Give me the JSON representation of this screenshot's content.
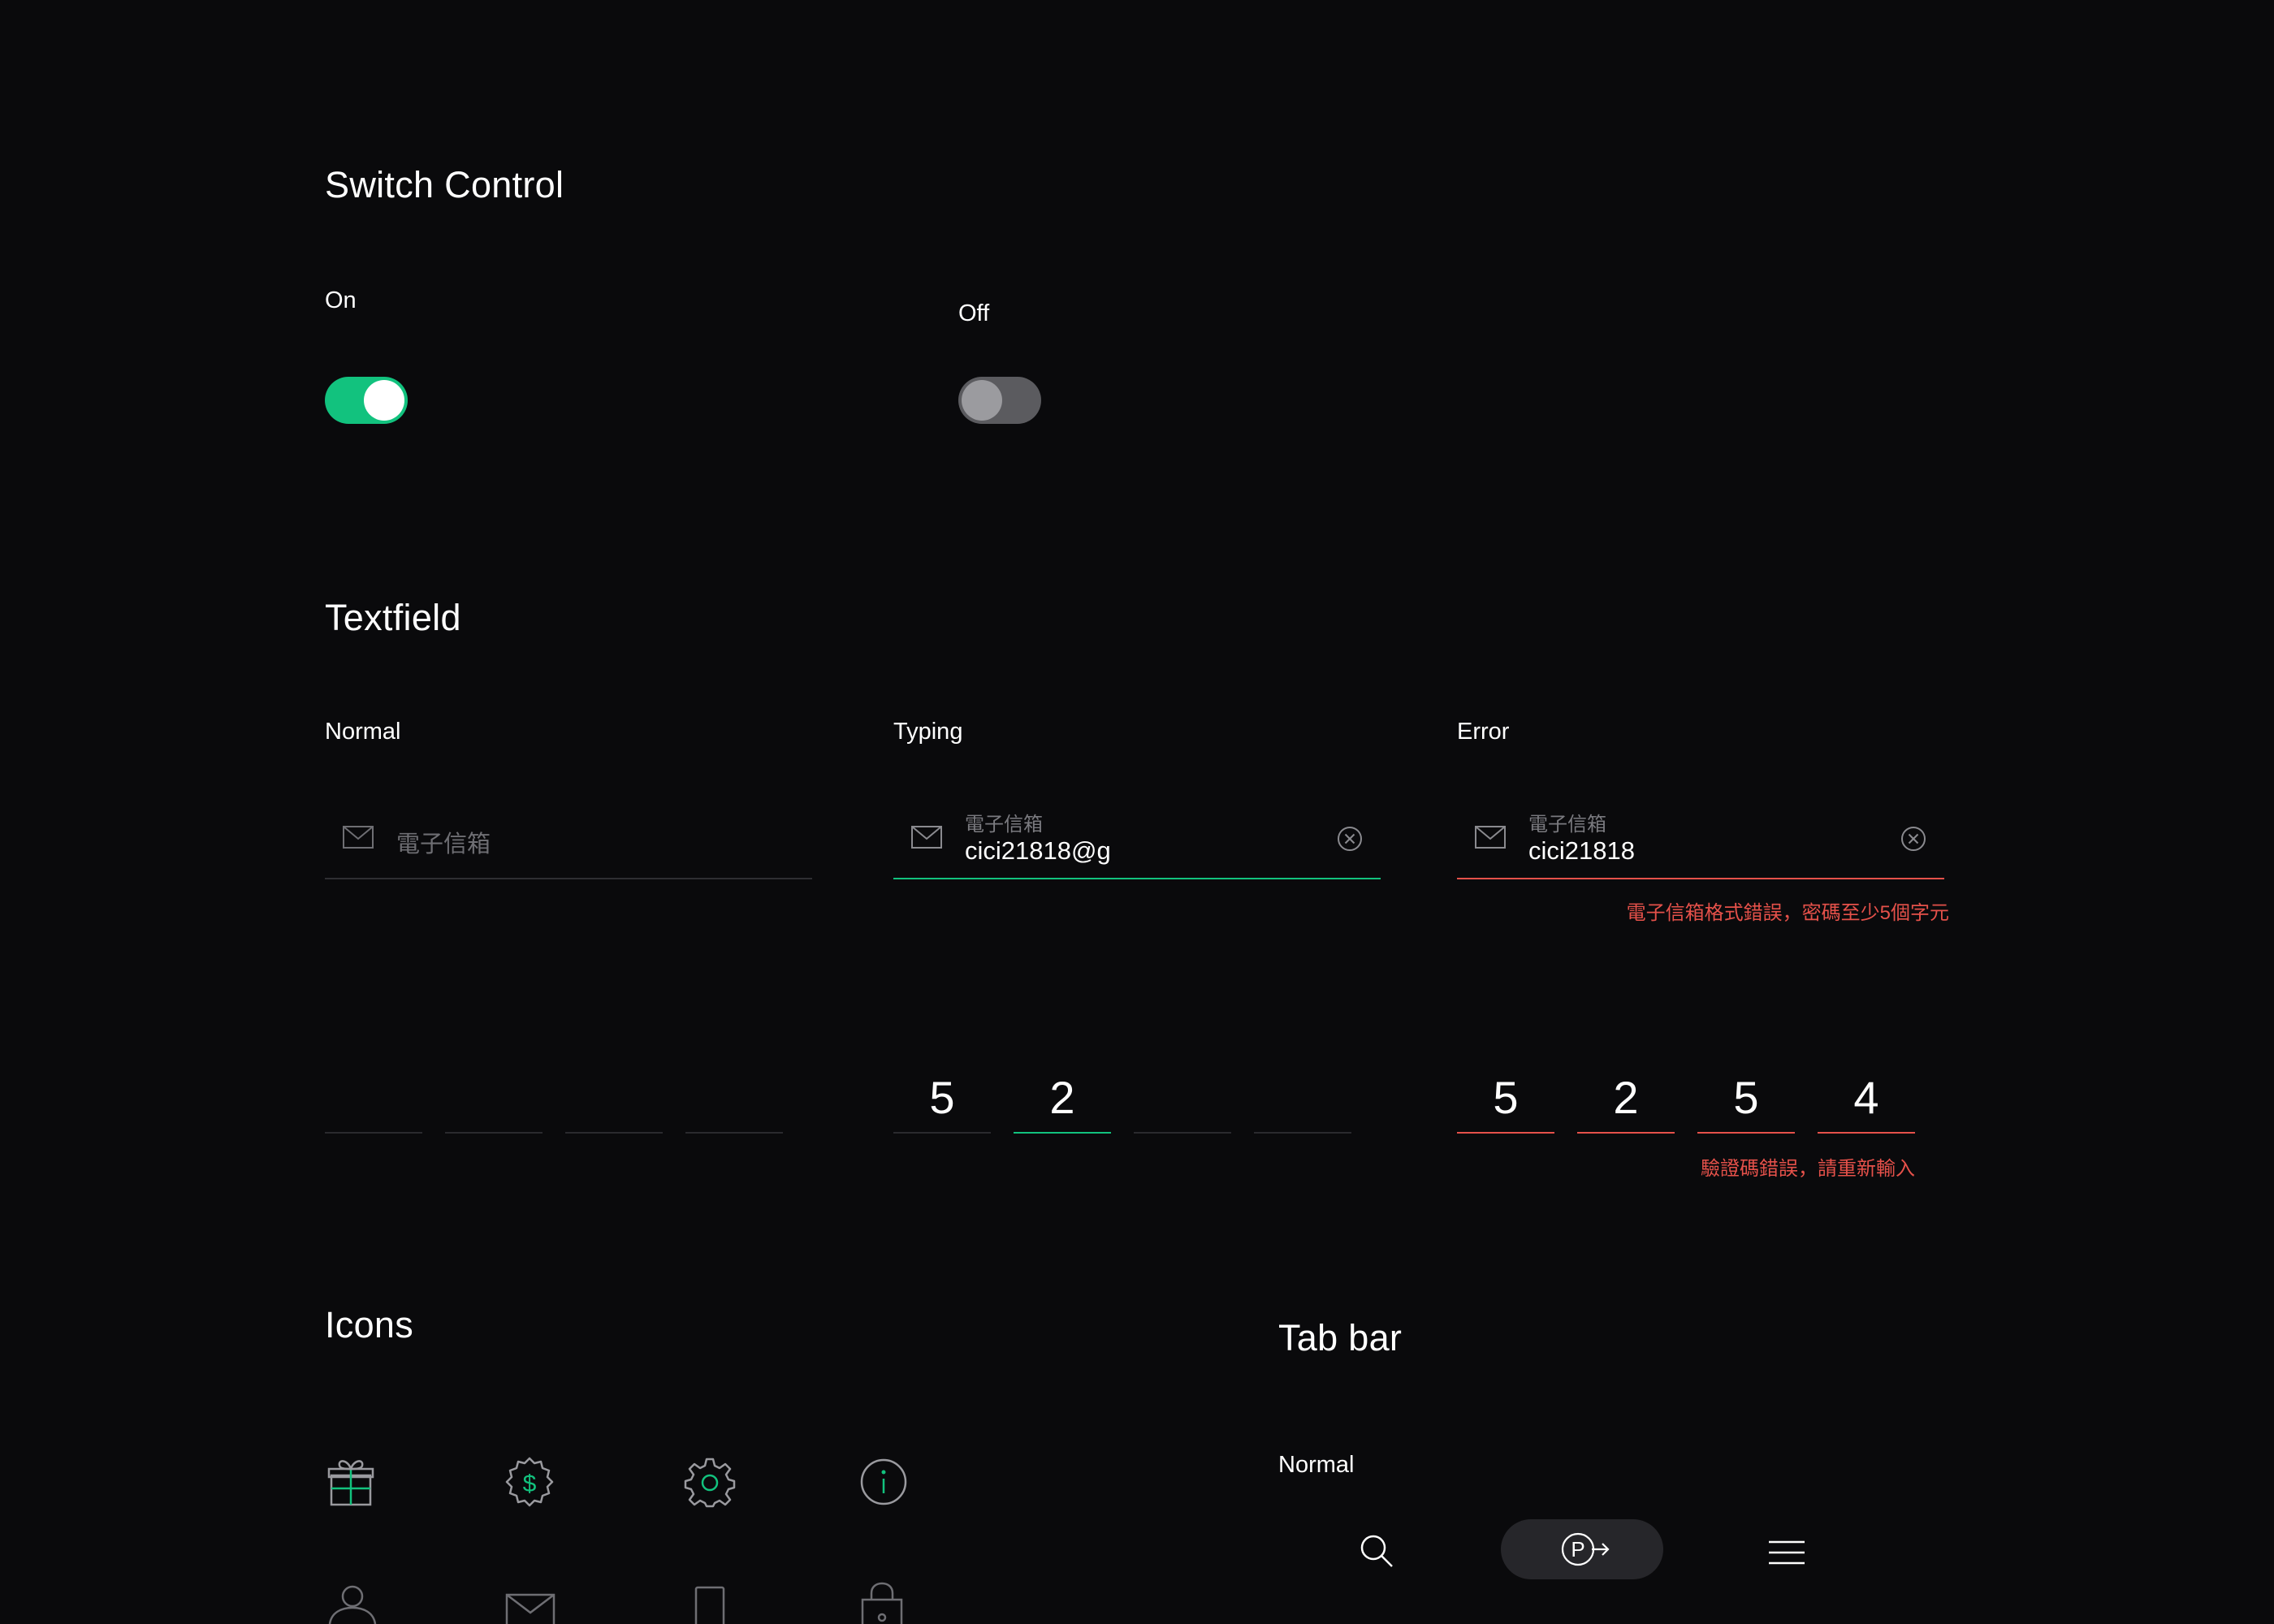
{
  "switch_section": {
    "title": "Switch Control",
    "on_label": "On",
    "off_label": "Off",
    "on_state": true,
    "off_state": false,
    "accent_color": "#12c27e"
  },
  "textfield_section": {
    "title": "Textfield",
    "normal": {
      "label": "Normal",
      "placeholder": "電子信箱"
    },
    "typing": {
      "label": "Typing",
      "float_label": "電子信箱",
      "value": "cici21818@g"
    },
    "error": {
      "label": "Error",
      "float_label": "電子信箱",
      "value": "cici21818",
      "message": "電子信箱格式錯誤，密碼至少5個字元",
      "color": "#e5514a"
    },
    "code_normal": [
      "",
      "",
      "",
      ""
    ],
    "code_typing": [
      "5",
      "2",
      "",
      ""
    ],
    "code_error": [
      "5",
      "2",
      "5",
      "4"
    ],
    "code_error_message": "驗證碼錯誤，請重新輸入"
  },
  "icons_section": {
    "title": "Icons",
    "icons": [
      "gift-icon",
      "dollar-badge-icon",
      "gear-icon",
      "info-icon",
      "user-icon",
      "mail-icon",
      "phone-icon",
      "lock-icon"
    ]
  },
  "tabbar_section": {
    "title": "Tab bar",
    "normal_label": "Normal",
    "tabs": [
      "search-icon",
      "parking-exit-icon",
      "menu-icon"
    ]
  }
}
